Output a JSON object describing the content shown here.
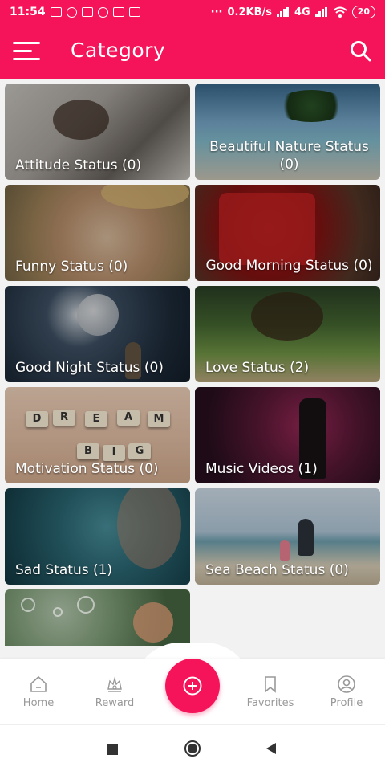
{
  "status_bar": {
    "time": "11:54",
    "speed": "0.2KB/s",
    "network": "4G",
    "battery": "20",
    "overflow": "···"
  },
  "app_bar": {
    "title": "Category",
    "menu_icon": "hamburger-menu-icon",
    "search_icon": "search-icon"
  },
  "categories": [
    {
      "label": "Attitude Status (0)"
    },
    {
      "label": "Beautiful Nature Status (0)"
    },
    {
      "label": "Funny Status (0)"
    },
    {
      "label": "Good Morning Status (0)"
    },
    {
      "label": "Good Night Status (0)"
    },
    {
      "label": "Love Status (2)"
    },
    {
      "label": "Motivation Status (0)"
    },
    {
      "label": "Music Videos (1)"
    },
    {
      "label": "Sad Status (1)"
    },
    {
      "label": "Sea Beach Status (0)"
    }
  ],
  "motivation_tiles": [
    "D",
    "R",
    "E",
    "A",
    "M",
    "B",
    "I",
    "G"
  ],
  "bottom_nav": {
    "home": "Home",
    "reward": "Reward",
    "favorites": "Favorites",
    "profile": "Profile"
  },
  "colors": {
    "accent": "#f5145a",
    "nav_inactive": "#999999"
  }
}
